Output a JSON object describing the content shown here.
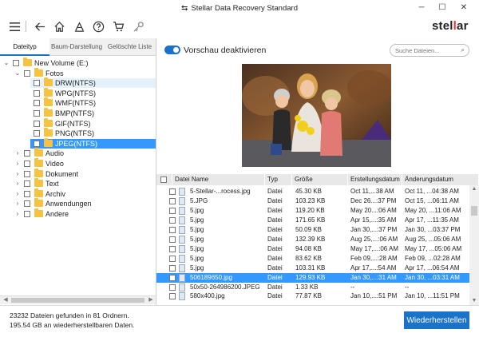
{
  "window": {
    "title": "Stellar Data Recovery Standard",
    "minimize": "─",
    "maximize": "☐",
    "close": "✕"
  },
  "logo": {
    "part1": "stel",
    "part2": "l",
    "part3": "ar"
  },
  "tabs": [
    {
      "label": "Dateityp",
      "active": true
    },
    {
      "label": "Baum-Darstellung",
      "active": false
    },
    {
      "label": "Gelöschte Liste",
      "active": false
    }
  ],
  "tree": [
    {
      "label": "New Volume (E:)",
      "expander": "⌄",
      "level": 0
    },
    {
      "label": "Fotos",
      "expander": "⌄",
      "level": 1
    },
    {
      "label": "DRW(NTFS)",
      "expander": "",
      "level": 2,
      "state": "hover"
    },
    {
      "label": "WPG(NTFS)",
      "expander": "",
      "level": 2
    },
    {
      "label": "WMF(NTFS)",
      "expander": "",
      "level": 2
    },
    {
      "label": "BMP(NTFS)",
      "expander": "",
      "level": 2
    },
    {
      "label": "GIF(NTFS)",
      "expander": "",
      "level": 2
    },
    {
      "label": "PNG(NTFS)",
      "expander": "",
      "level": 2
    },
    {
      "label": "JPEG(NTFS)",
      "expander": "",
      "level": 2,
      "state": "selected"
    },
    {
      "label": "Audio",
      "expander": "›",
      "level": 1
    },
    {
      "label": "Video",
      "expander": "›",
      "level": 1
    },
    {
      "label": "Dokument",
      "expander": "›",
      "level": 1
    },
    {
      "label": "Text",
      "expander": "›",
      "level": 1
    },
    {
      "label": "Archiv",
      "expander": "›",
      "level": 1
    },
    {
      "label": "Anwendungen",
      "expander": "›",
      "level": 1
    },
    {
      "label": "Andere",
      "expander": "›",
      "level": 1
    }
  ],
  "preview": {
    "toggle_label": "Vorschau deaktivieren",
    "search_placeholder": "Suche Dateien...",
    "colors": {
      "toggle": "#1a73c9",
      "selection": "#3399ff"
    }
  },
  "table": {
    "headers": [
      "Datei Name",
      "Typ",
      "Größe",
      "Erstellungsdatum",
      "Änderungsdatum"
    ],
    "rows": [
      [
        "5-Stellar-...rocess.jpg",
        "Datei",
        "45.30 KB",
        "Oct 11,...38 AM",
        "Oct 11, ...04:38 AM"
      ],
      [
        "5.JPG",
        "Datei",
        "103.23 KB",
        "Dec 26...:37 PM",
        "Oct 15, ...06:11 AM"
      ],
      [
        "5.jpg",
        "Datei",
        "119.20 KB",
        "May 20...:06 AM",
        "May 20, ...11:06 AM"
      ],
      [
        "5.jpg",
        "Datei",
        "171.65 KB",
        "Apr 15,...:35 AM",
        "Apr 17, ...11:35 AM"
      ],
      [
        "5.jpg",
        "Datei",
        "50.09 KB",
        "Jan 30,...:37 PM",
        "Jan 30, ...03:37 PM"
      ],
      [
        "5.jpg",
        "Datei",
        "132.39 KB",
        "Aug 25,...:06 AM",
        "Aug 25, ...05:06 AM"
      ],
      [
        "5.jpg",
        "Datei",
        "94.08 KB",
        "May 17,...:06 AM",
        "May 17, ...05:06 AM"
      ],
      [
        "5.jpg",
        "Datei",
        "83.62 KB",
        "Feb 09,...:28 AM",
        "Feb 09, ...02:28 AM"
      ],
      [
        "5.jpg",
        "Datei",
        "103.31 KB",
        "Apr 17,...:54 AM",
        "Apr 17, ...06:54 AM"
      ],
      [
        "506189650.jpg",
        "Datei",
        "129.93 KB",
        "Jan 30,...:31 AM",
        "Jan 30, ...03:31 AM"
      ],
      [
        "50x50-264986200.JPEG",
        "Datei",
        "1.33 KB",
        "--",
        "--"
      ],
      [
        "580x400.jpg",
        "Datei",
        "77.87 KB",
        "Jan 10,...:51 PM",
        "Jan 10, ...11:51 PM"
      ]
    ],
    "selected_row": 9
  },
  "status": {
    "line1": "23232 Dateien gefunden in 81 Ordnern.",
    "line2": "195.54 GB an wiederherstellbaren Daten."
  },
  "recover_button": "Wiederherstellen",
  "icons": [
    "menu-icon",
    "back-icon",
    "home-icon",
    "scan-icon",
    "help-icon",
    "cart-icon",
    "key-icon",
    "search-icon",
    "recover-arrows-icon"
  ]
}
